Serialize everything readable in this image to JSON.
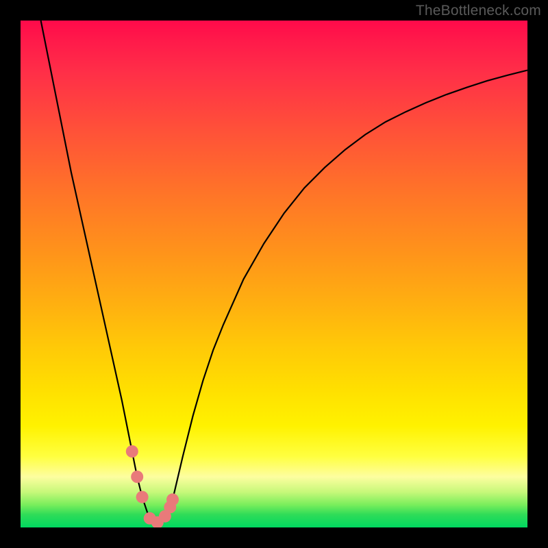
{
  "watermark": "TheBottleneck.com",
  "chart_data": {
    "type": "line",
    "title": "",
    "xlabel": "",
    "ylabel": "",
    "xlim": [
      0,
      100
    ],
    "ylim": [
      0,
      100
    ],
    "series": [
      {
        "name": "bottleneck-curve",
        "x": [
          4,
          6,
          8,
          10,
          12,
          14,
          16,
          18,
          20,
          22,
          23,
          24,
          25,
          26,
          27,
          28,
          29,
          30,
          32,
          34,
          36,
          38,
          40,
          44,
          48,
          52,
          56,
          60,
          64,
          68,
          72,
          76,
          80,
          84,
          88,
          92,
          96,
          100
        ],
        "values": [
          100,
          90,
          80,
          70,
          61,
          52,
          43,
          34,
          25,
          15,
          10,
          6,
          3,
          1.2,
          0.7,
          1.1,
          2.5,
          5.5,
          14,
          22,
          29,
          35,
          40,
          49,
          56,
          62,
          67,
          71,
          74.5,
          77.5,
          80,
          82,
          83.8,
          85.4,
          86.8,
          88.1,
          89.2,
          90.2
        ]
      }
    ],
    "markers": {
      "name": "highlight-points",
      "x": [
        22,
        23,
        24,
        25.5,
        27,
        28.5,
        29.5,
        30
      ],
      "values": [
        15,
        10,
        6,
        1.8,
        1.0,
        2.2,
        4.0,
        5.5
      ]
    },
    "colors": {
      "gradient_top": "#ff0a4a",
      "gradient_bottom": "#00d860",
      "curve": "#000000",
      "marker": "#e97a7a",
      "frame": "#000000"
    }
  }
}
